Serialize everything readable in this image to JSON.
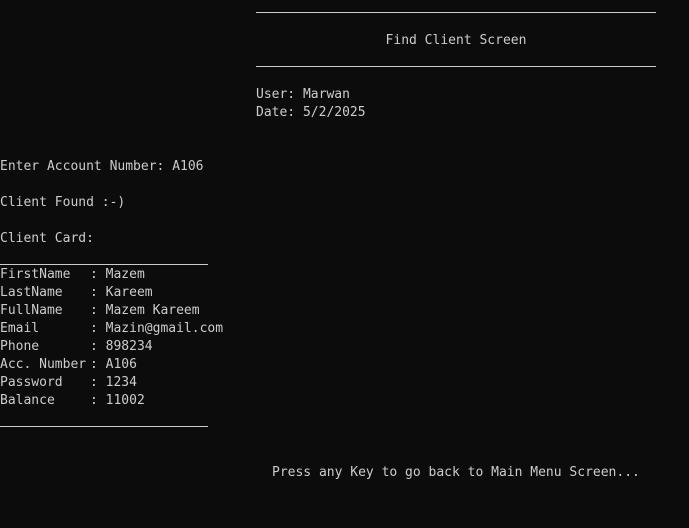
{
  "header": {
    "title": "Find Client Screen",
    "user_label": "User:",
    "user_value": "Marwan",
    "date_label": "Date:",
    "date_value": "5/2/2025"
  },
  "prompt": {
    "label": "Enter Account Number:",
    "value": "A106"
  },
  "result_message": "Client Found :-)",
  "card": {
    "title": "Client Card:",
    "fields": [
      {
        "label": "FirstName",
        "value": "Mazem"
      },
      {
        "label": "LastName",
        "value": "Kareem"
      },
      {
        "label": "FullName",
        "value": "Mazem Kareem"
      },
      {
        "label": "Email",
        "value": "Mazin@gmail.com"
      },
      {
        "label": "Phone",
        "value": "898234"
      },
      {
        "label": "Acc. Number",
        "value": "A106"
      },
      {
        "label": "Password",
        "value": "1234"
      },
      {
        "label": "Balance",
        "value": "11002"
      }
    ]
  },
  "footer_message": "Press any Key to go back to Main Menu Screen...",
  "colors": {
    "background": "#0c0c0c",
    "text": "#cccccc"
  }
}
